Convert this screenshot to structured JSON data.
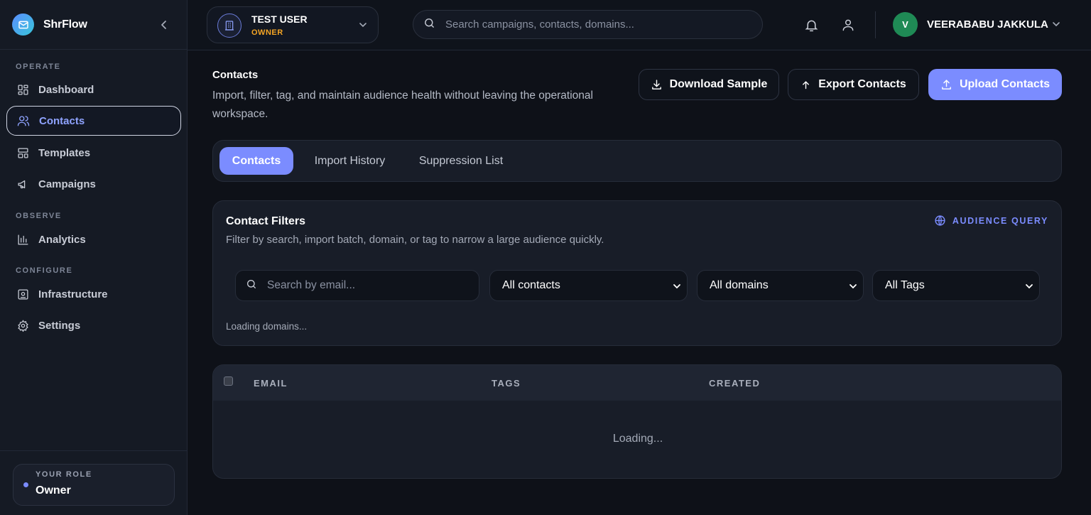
{
  "app": {
    "name": "ShrFlow"
  },
  "sidebar": {
    "sections": [
      {
        "label": "OPERATE"
      },
      {
        "label": "OBSERVE"
      },
      {
        "label": "CONFIGURE"
      }
    ],
    "items": [
      {
        "label": "Dashboard",
        "icon": "dashboard-icon"
      },
      {
        "label": "Contacts",
        "icon": "users-icon",
        "active": true
      },
      {
        "label": "Templates",
        "icon": "template-icon"
      },
      {
        "label": "Campaigns",
        "icon": "megaphone-icon"
      },
      {
        "label": "Analytics",
        "icon": "bar-chart-icon"
      },
      {
        "label": "Infrastructure",
        "icon": "server-icon"
      },
      {
        "label": "Settings",
        "icon": "gear-icon"
      }
    ],
    "role": {
      "label": "YOUR ROLE",
      "value": "Owner"
    }
  },
  "topbar": {
    "org": {
      "name": "TEST USER",
      "role": "OWNER"
    },
    "search_placeholder": "Search campaigns, contacts, domains...",
    "user": {
      "initial": "V",
      "name": "VEERABABU JAKKULA"
    }
  },
  "page": {
    "title": "Contacts",
    "description": "Import, filter, tag, and maintain audience health without leaving the operational workspace.",
    "actions": {
      "download_sample": "Download Sample",
      "export_contacts": "Export Contacts",
      "upload_contacts": "Upload Contacts"
    },
    "tabs": [
      {
        "label": "Contacts",
        "active": true
      },
      {
        "label": "Import History"
      },
      {
        "label": "Suppression List"
      }
    ]
  },
  "filters": {
    "title": "Contact Filters",
    "description": "Filter by search, import batch, domain, or tag to narrow a large audience quickly.",
    "audience_query": "AUDIENCE QUERY",
    "search_placeholder": "Search by email...",
    "contacts_select": "All contacts",
    "domains_select": "All domains",
    "tags_select": "All Tags",
    "status": "Loading domains..."
  },
  "table": {
    "columns": [
      "EMAIL",
      "TAGS",
      "CREATED"
    ],
    "status": "Loading..."
  },
  "colors": {
    "accent": "#7b8cff",
    "owner_badge": "#f5a524",
    "avatar": "#1f8a55",
    "background": "#0e1118",
    "panel": "#181d28"
  }
}
